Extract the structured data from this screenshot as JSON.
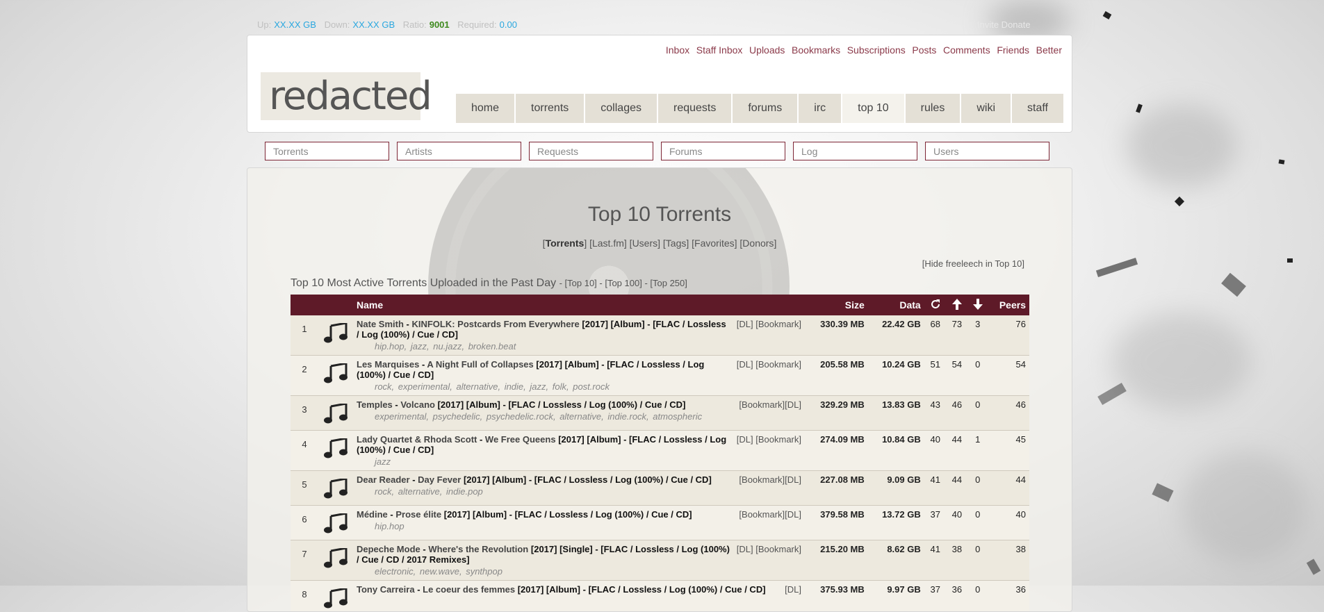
{
  "stats": {
    "up_label": "Up:",
    "up_value": "XX.XX GB",
    "down_label": "Down:",
    "down_value": "XX.XX GB",
    "ratio_label": "Ratio:",
    "ratio_value": "9001",
    "required_label": "Required:",
    "required_value": "0.00",
    "faint_links": "Invite Donate"
  },
  "userlinks": [
    "Inbox",
    "Staff Inbox",
    "Uploads",
    "Bookmarks",
    "Subscriptions",
    "Posts",
    "Comments",
    "Friends",
    "Better"
  ],
  "logo_text": "redacted",
  "mainnav": [
    "home",
    "torrents",
    "collages",
    "requests",
    "forums",
    "irc",
    "top 10",
    "rules",
    "wiki",
    "staff"
  ],
  "mainnav_active": "top 10",
  "search": [
    "Torrents",
    "Artists",
    "Requests",
    "Forums",
    "Log",
    "Users"
  ],
  "page": {
    "title": "Top 10 Torrents",
    "subnav": [
      "Torrents",
      "Last.fm",
      "Users",
      "Tags",
      "Favorites",
      "Donors"
    ],
    "hide_freeleech": "[Hide freeleech in Top 10]",
    "section_title": "Top 10 Most Active Torrents Uploaded in the Past Day",
    "section_links": "- [Top 10] - [Top 100] - [Top 250]"
  },
  "table": {
    "headers": {
      "name": "Name",
      "size": "Size",
      "data": "Data",
      "peers": "Peers"
    },
    "header_icons": [
      "snatches-icon",
      "seeders-up-arrow-icon",
      "leechers-down-arrow-icon"
    ],
    "rows": [
      {
        "rank": "1",
        "artist": "Nate Smith",
        "album": "KINFOLK: Postcards From Everywhere",
        "info": "[2017] [Album] - [FLAC / Lossless / Log (100%) / Cue / CD]",
        "tags": [
          "hip.hop",
          "jazz",
          "nu.jazz",
          "broken.beat"
        ],
        "links": "[DL] [Bookmark]",
        "size": "330.39 MB",
        "data": "22.42 GB",
        "snatched": "68",
        "seeders": "73",
        "leechers": "3",
        "peers": "76"
      },
      {
        "rank": "2",
        "artist": "Les Marquises",
        "album": "A Night Full of Collapses",
        "info": "[2017] [Album] - [FLAC / Lossless / Log (100%) / Cue / CD]",
        "tags": [
          "rock",
          "experimental",
          "alternative",
          "indie",
          "jazz",
          "folk",
          "post.rock"
        ],
        "links": "[DL] [Bookmark]",
        "size": "205.58 MB",
        "data": "10.24 GB",
        "snatched": "51",
        "seeders": "54",
        "leechers": "0",
        "peers": "54"
      },
      {
        "rank": "3",
        "artist": "Temples",
        "album": "Volcano",
        "info": "[2017] [Album] - [FLAC / Lossless / Log (100%) / Cue / CD]",
        "tags": [
          "experimental",
          "psychedelic",
          "psychedelic.rock",
          "alternative",
          "indie.rock",
          "atmospheric"
        ],
        "links": "[Bookmark][DL]",
        "size": "329.29 MB",
        "data": "13.83 GB",
        "snatched": "43",
        "seeders": "46",
        "leechers": "0",
        "peers": "46"
      },
      {
        "rank": "4",
        "artist": "Lady Quartet & Rhoda Scott",
        "album": "We Free Queens",
        "info": "[2017] [Album] - [FLAC / Lossless / Log (100%) / Cue / CD]",
        "tags": [
          "jazz"
        ],
        "links": "[DL] [Bookmark]",
        "size": "274.09 MB",
        "data": "10.84 GB",
        "snatched": "40",
        "seeders": "44",
        "leechers": "1",
        "peers": "45"
      },
      {
        "rank": "5",
        "artist": "Dear Reader",
        "album": "Day Fever",
        "info": "[2017] [Album] - [FLAC / Lossless / Log (100%) / Cue / CD]",
        "tags": [
          "rock",
          "alternative",
          "indie.pop"
        ],
        "links": "[Bookmark][DL]",
        "size": "227.08 MB",
        "data": "9.09 GB",
        "snatched": "41",
        "seeders": "44",
        "leechers": "0",
        "peers": "44"
      },
      {
        "rank": "6",
        "artist": "Médine",
        "album": "Prose élite",
        "info": "[2017] [Album] - [FLAC / Lossless / Log (100%) / Cue / CD]",
        "tags": [
          "hip.hop"
        ],
        "links": "[Bookmark][DL]",
        "size": "379.58 MB",
        "data": "13.72 GB",
        "snatched": "37",
        "seeders": "40",
        "leechers": "0",
        "peers": "40"
      },
      {
        "rank": "7",
        "artist": "Depeche Mode",
        "album": "Where's the Revolution",
        "info": "[2017] [Single] - [FLAC / Lossless / Log (100%) / Cue / CD / 2017 Remixes]",
        "tags": [
          "electronic",
          "new.wave",
          "synthpop"
        ],
        "links": "[DL] [Bookmark]",
        "size": "215.20 MB",
        "data": "8.62 GB",
        "snatched": "41",
        "seeders": "38",
        "leechers": "0",
        "peers": "38"
      },
      {
        "rank": "8",
        "artist": "Tony Carreira",
        "album": "Le coeur des femmes",
        "info": "[2017] [Album] - [FLAC / Lossless / Log (100%) / Cue / CD]",
        "tags": [],
        "links": "[DL]",
        "size": "375.93 MB",
        "data": "9.97 GB",
        "snatched": "37",
        "seeders": "36",
        "leechers": "0",
        "peers": "36"
      }
    ]
  }
}
